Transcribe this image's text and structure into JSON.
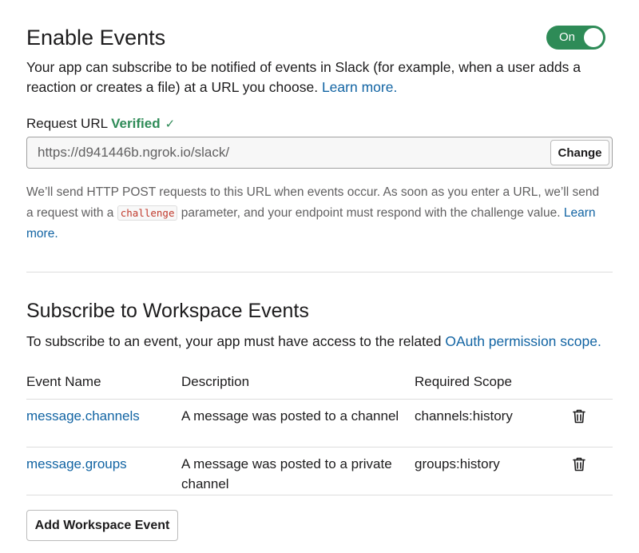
{
  "events_section": {
    "title": "Enable Events",
    "toggle_label": "On",
    "intro_text": "Your app can subscribe to be notified of events in Slack (for example, when a user adds a reaction or creates a file) at a URL you choose. ",
    "intro_link": "Learn more.",
    "request_url_label": "Request URL",
    "verified_label": "Verified",
    "verified_icon": "✓",
    "request_url_value": "https://d941446b.ngrok.io/slack/",
    "change_button": "Change",
    "help_text_1": "We’ll send HTTP POST requests to this URL when events occur. As soon as you enter a URL, we’ll send a request with a ",
    "help_code": "challenge",
    "help_text_2": " parameter, and your endpoint must respond with the challenge value. ",
    "help_link": "Learn more."
  },
  "workspace_section": {
    "title": "Subscribe to Workspace Events",
    "subtitle_text": "To subscribe to an event, your app must have access to the related ",
    "subtitle_link": "OAuth permission scope.",
    "columns": [
      "Event Name",
      "Description",
      "Required Scope"
    ],
    "rows": [
      {
        "name": "message.channels",
        "description": "A message was posted to a channel",
        "scope": "channels:history"
      },
      {
        "name": "message.groups",
        "description": "A message was posted to a private channel",
        "scope": "groups:history"
      }
    ],
    "add_button": "Add Workspace Event"
  },
  "colors": {
    "accent_green": "#2e8b57",
    "link_blue": "#1264a3"
  },
  "icons": {
    "delete": "trash-icon",
    "verified": "check-icon"
  }
}
